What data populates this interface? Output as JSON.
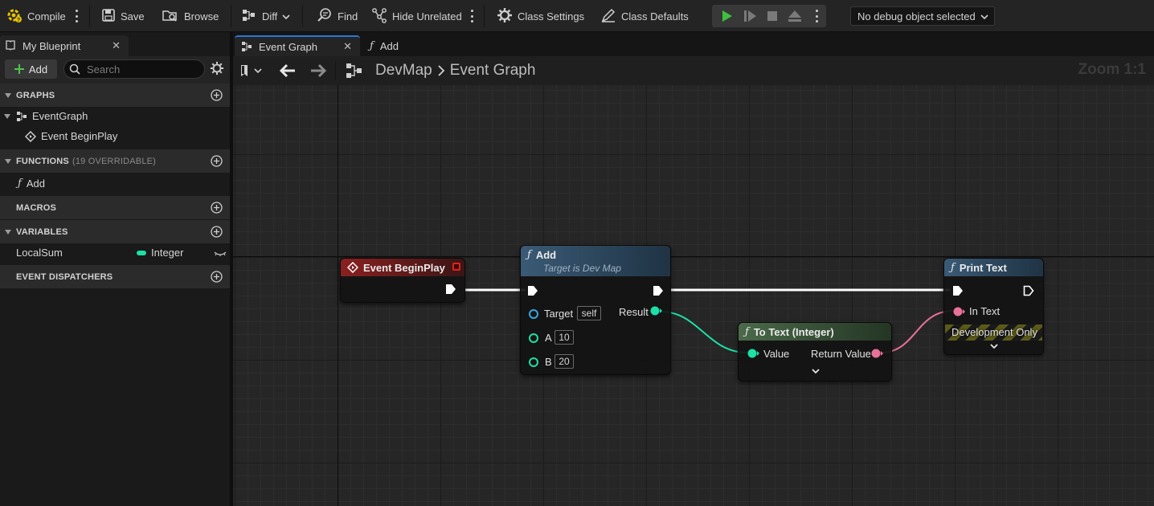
{
  "toolbar": {
    "compile": "Compile",
    "save": "Save",
    "browse": "Browse",
    "diff": "Diff",
    "find": "Find",
    "hide_unrelated": "Hide Unrelated",
    "class_settings": "Class Settings",
    "class_defaults": "Class Defaults",
    "debug_selector": "No debug object selected"
  },
  "left_panel": {
    "tab_title": "My Blueprint",
    "add_label": "Add",
    "search_placeholder": "Search",
    "sections": {
      "graphs": "GRAPHS",
      "functions": "FUNCTIONS",
      "functions_note": "(19 OVERRIDABLE)",
      "macros": "MACROS",
      "variables": "VARIABLES",
      "event_dispatchers": "EVENT DISPATCHERS"
    },
    "graphs": {
      "event_graph": "EventGraph",
      "begin_play": "Event BeginPlay"
    },
    "functions": [
      "Add"
    ],
    "variables": [
      {
        "name": "LocalSum",
        "type": "Integer",
        "type_color": "#1de0a6"
      }
    ]
  },
  "graph": {
    "tabs": [
      {
        "label": "Event Graph",
        "active": true
      },
      {
        "label": "Add",
        "active": false
      }
    ],
    "breadcrumb": {
      "root": "DevMap",
      "current": "Event Graph"
    },
    "zoom": "Zoom 1:1",
    "nodes": {
      "begin_play": {
        "title": "Event BeginPlay",
        "color": "#7a1e1e"
      },
      "add": {
        "title": "Add",
        "subtitle": "Target is Dev Map",
        "pins": {
          "target": "Target",
          "target_value": "self",
          "a": "A",
          "a_value": "10",
          "b": "B",
          "b_value": "20",
          "result": "Result"
        },
        "color": "#2c4a60"
      },
      "to_text": {
        "title": "To Text (Integer)",
        "value": "Value",
        "return_value": "Return Value",
        "color": "#3e5b3e"
      },
      "print_text": {
        "title": "Print Text",
        "in_text": "In Text",
        "dev_only": "Development Only",
        "color": "#2c4a60"
      }
    },
    "colors": {
      "integer_pin": "#1de0a6",
      "text_pin": "#e8719b",
      "object_pin": "#38a5e6",
      "exec_pin": "#ffffff"
    }
  }
}
